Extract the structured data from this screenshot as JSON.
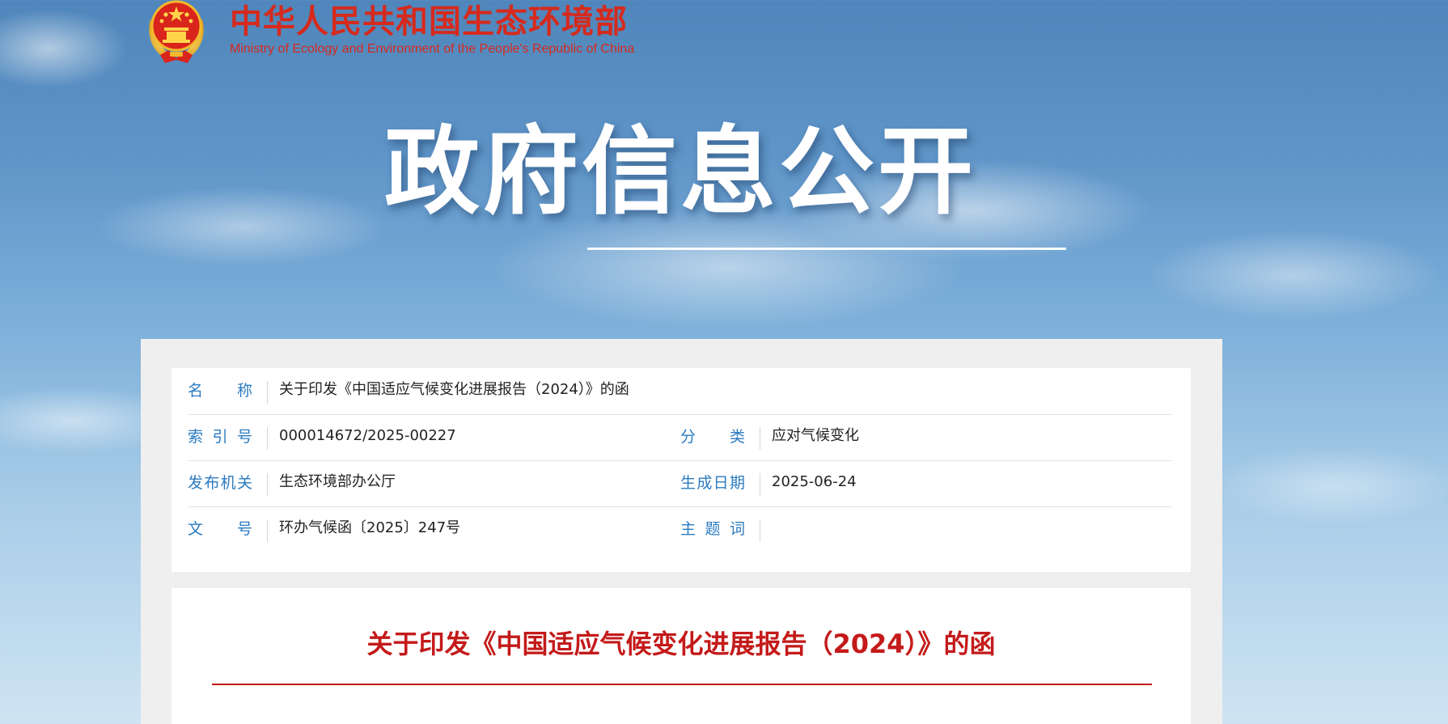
{
  "header": {
    "emblem_icon": "national-emblem-icon",
    "name_cn": "中华人民共和国生态环境部",
    "name_en": "Ministry of Ecology and Environment of the People's Republic of China",
    "brand_color": "#d52a1d"
  },
  "hero": {
    "title": "政府信息公开"
  },
  "meta": {
    "label_color": "#2b7bc0",
    "name_label": "名　　称",
    "name_value": "关于印发《中国适应气候变化进展报告（2024）》的函",
    "index_label": "索 引 号",
    "index_value": "000014672/2025-00227",
    "category_label": "分　　类",
    "category_value": "应对气候变化",
    "issuer_label": "发布机关",
    "issuer_value": "生态环境部办公厅",
    "date_label": "生成日期",
    "date_value": "2025-06-24",
    "docno_label": "文　　号",
    "docno_value": "环办气候函〔2025〕247号",
    "keywords_label": "主 题 词",
    "keywords_value": ""
  },
  "document": {
    "title": "关于印发《中国适应气候变化进展报告（2024）》的函",
    "title_color": "#c41a1a"
  }
}
